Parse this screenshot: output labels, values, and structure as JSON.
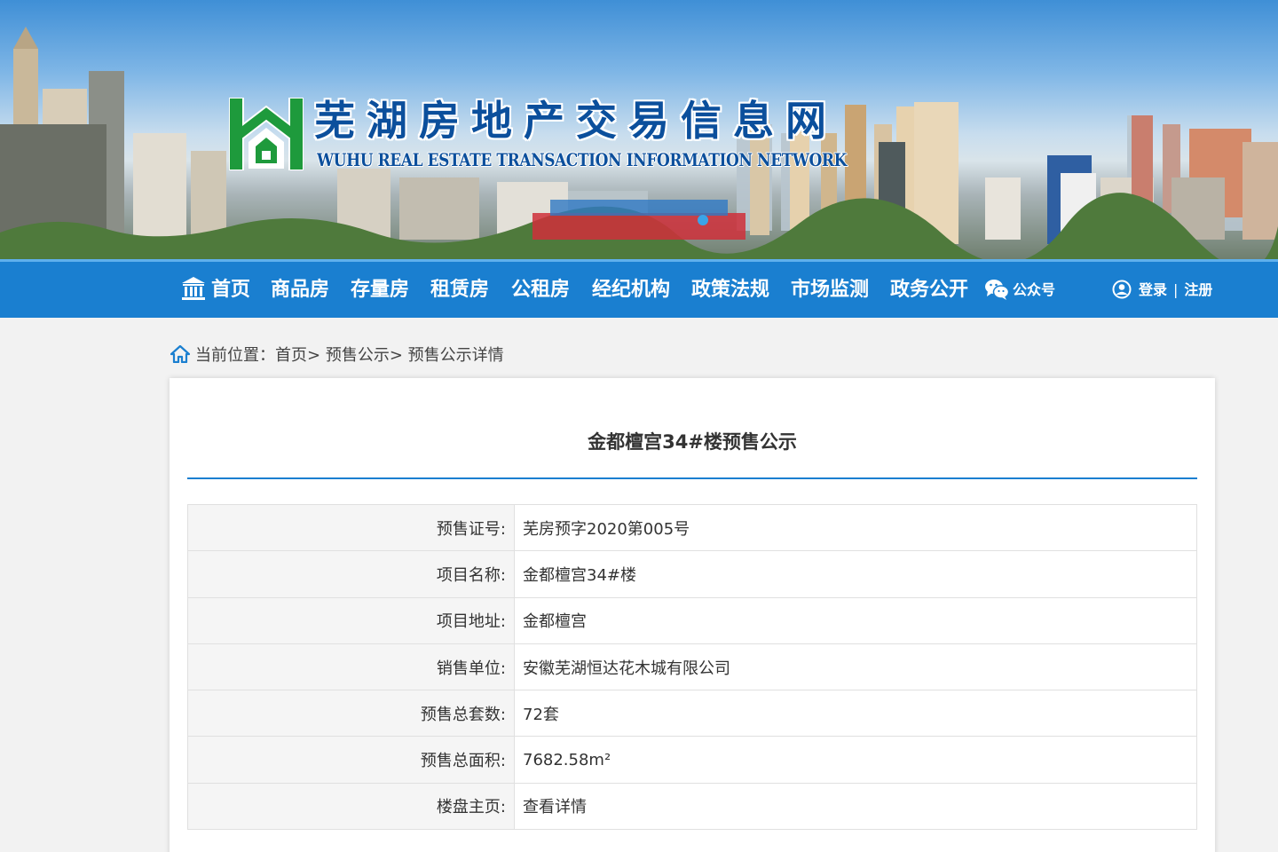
{
  "site": {
    "title_cn": "芜湖房地产交易信息网",
    "title_en": "WUHU REAL ESTATE TRANSACTION INFORMATION NETWORK"
  },
  "nav": {
    "items": [
      "首页",
      "商品房",
      "存量房",
      "租赁房",
      "公租房",
      "经纪机构",
      "政策法规",
      "市场监测",
      "政务公开"
    ],
    "wechat": "公众号",
    "login": "登录",
    "separator": "|",
    "register": "注册"
  },
  "breadcrumb": {
    "prefix": "当前位置：",
    "items": [
      "首页",
      "预售公示",
      "预售公示详情"
    ],
    "separator": ">"
  },
  "detail": {
    "title": "金都檀宫34#楼预售公示",
    "rows": [
      {
        "label": "预售证号:",
        "value": "芜房预字2020第005号"
      },
      {
        "label": "项目名称:",
        "value": "金都檀宫34#楼"
      },
      {
        "label": "项目地址:",
        "value": "金都檀宫"
      },
      {
        "label": "销售单位:",
        "value": "安徽芜湖恒达花木城有限公司"
      },
      {
        "label": "预售总套数:",
        "value": "72套"
      },
      {
        "label": "预售总面积:",
        "value": "7682.58m²"
      },
      {
        "label": "楼盘主页:",
        "value": "查看详情"
      }
    ]
  },
  "colors": {
    "nav_bg": "#1a7fd0",
    "accent_line": "#1a7fd0",
    "logo_green": "#1e9a3c",
    "title_blue": "#0b4f9c"
  },
  "icons": {
    "home_nav": "bank-building-icon",
    "wechat": "wechat-icon",
    "user": "user-circle-icon",
    "breadcrumb": "home-icon"
  }
}
